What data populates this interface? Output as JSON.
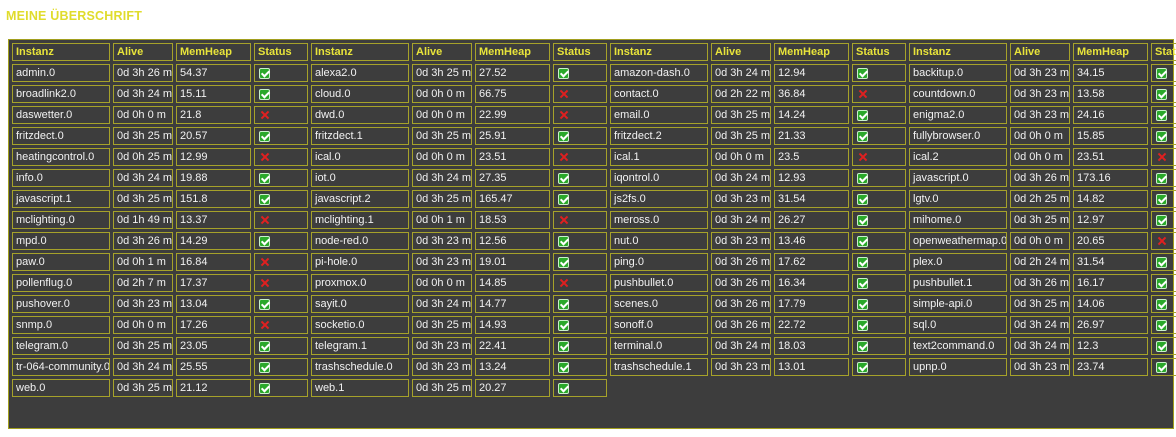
{
  "page": {
    "title": "MEINE ÜBERSCHRIFT"
  },
  "table": {
    "headers": [
      "Instanz",
      "Alive",
      "MemHeap",
      "Status"
    ],
    "column_groups": 4,
    "status_icons": {
      "ok": "check-icon",
      "fail": "cross-icon"
    },
    "colors": {
      "header_text": "#e8e43a",
      "border": "#a6a22a",
      "background": "#3d3d3d",
      "ok": "#2aa82a",
      "fail": "#e02020"
    },
    "rows": [
      [
        {
          "instance": "admin.0",
          "alive": "0d 3h 26 m",
          "memheap": "54.37",
          "ok": true
        },
        {
          "instance": "alexa2.0",
          "alive": "0d 3h 25 m",
          "memheap": "27.52",
          "ok": true
        },
        {
          "instance": "amazon-dash.0",
          "alive": "0d 3h 24 m",
          "memheap": "12.94",
          "ok": true
        },
        {
          "instance": "backitup.0",
          "alive": "0d 3h 23 m",
          "memheap": "34.15",
          "ok": true
        }
      ],
      [
        {
          "instance": "broadlink2.0",
          "alive": "0d 3h 24 m",
          "memheap": "15.11",
          "ok": true
        },
        {
          "instance": "cloud.0",
          "alive": "0d 0h 0 m",
          "memheap": "66.75",
          "ok": false
        },
        {
          "instance": "contact.0",
          "alive": "0d 2h 22 m",
          "memheap": "36.84",
          "ok": false
        },
        {
          "instance": "countdown.0",
          "alive": "0d 3h 23 m",
          "memheap": "13.58",
          "ok": true
        }
      ],
      [
        {
          "instance": "daswetter.0",
          "alive": "0d 0h 0 m",
          "memheap": "21.8",
          "ok": false
        },
        {
          "instance": "dwd.0",
          "alive": "0d 0h 0 m",
          "memheap": "22.99",
          "ok": false
        },
        {
          "instance": "email.0",
          "alive": "0d 3h 25 m",
          "memheap": "14.24",
          "ok": true
        },
        {
          "instance": "enigma2.0",
          "alive": "0d 3h 23 m",
          "memheap": "24.16",
          "ok": true
        }
      ],
      [
        {
          "instance": "fritzdect.0",
          "alive": "0d 3h 25 m",
          "memheap": "20.57",
          "ok": true
        },
        {
          "instance": "fritzdect.1",
          "alive": "0d 3h 25 m",
          "memheap": "25.91",
          "ok": true
        },
        {
          "instance": "fritzdect.2",
          "alive": "0d 3h 25 m",
          "memheap": "21.33",
          "ok": true
        },
        {
          "instance": "fullybrowser.0",
          "alive": "0d 0h 0 m",
          "memheap": "15.85",
          "ok": true
        }
      ],
      [
        {
          "instance": "heatingcontrol.0",
          "alive": "0d 0h 25 m",
          "memheap": "12.99",
          "ok": false
        },
        {
          "instance": "ical.0",
          "alive": "0d 0h 0 m",
          "memheap": "23.51",
          "ok": false
        },
        {
          "instance": "ical.1",
          "alive": "0d 0h 0 m",
          "memheap": "23.5",
          "ok": false
        },
        {
          "instance": "ical.2",
          "alive": "0d 0h 0 m",
          "memheap": "23.51",
          "ok": false
        }
      ],
      [
        {
          "instance": "info.0",
          "alive": "0d 3h 24 m",
          "memheap": "19.88",
          "ok": true
        },
        {
          "instance": "iot.0",
          "alive": "0d 3h 24 m",
          "memheap": "27.35",
          "ok": true
        },
        {
          "instance": "iqontrol.0",
          "alive": "0d 3h 24 m",
          "memheap": "12.93",
          "ok": true
        },
        {
          "instance": "javascript.0",
          "alive": "0d 3h 26 m",
          "memheap": "173.16",
          "ok": true
        }
      ],
      [
        {
          "instance": "javascript.1",
          "alive": "0d 3h 25 m",
          "memheap": "151.8",
          "ok": true
        },
        {
          "instance": "javascript.2",
          "alive": "0d 3h 25 m",
          "memheap": "165.47",
          "ok": true
        },
        {
          "instance": "js2fs.0",
          "alive": "0d 3h 23 m",
          "memheap": "31.54",
          "ok": true
        },
        {
          "instance": "lgtv.0",
          "alive": "0d 2h 25 m",
          "memheap": "14.82",
          "ok": true
        }
      ],
      [
        {
          "instance": "mclighting.0",
          "alive": "0d 1h 49 m",
          "memheap": "13.37",
          "ok": false
        },
        {
          "instance": "mclighting.1",
          "alive": "0d 0h 1 m",
          "memheap": "18.53",
          "ok": false
        },
        {
          "instance": "meross.0",
          "alive": "0d 3h 24 m",
          "memheap": "26.27",
          "ok": true
        },
        {
          "instance": "mihome.0",
          "alive": "0d 3h 25 m",
          "memheap": "12.97",
          "ok": true
        }
      ],
      [
        {
          "instance": "mpd.0",
          "alive": "0d 3h 26 m",
          "memheap": "14.29",
          "ok": true
        },
        {
          "instance": "node-red.0",
          "alive": "0d 3h 23 m",
          "memheap": "12.56",
          "ok": true
        },
        {
          "instance": "nut.0",
          "alive": "0d 3h 23 m",
          "memheap": "13.46",
          "ok": true
        },
        {
          "instance": "openweathermap.0",
          "alive": "0d 0h 0 m",
          "memheap": "20.65",
          "ok": false
        }
      ],
      [
        {
          "instance": "paw.0",
          "alive": "0d 0h 1 m",
          "memheap": "16.84",
          "ok": false
        },
        {
          "instance": "pi-hole.0",
          "alive": "0d 3h 23 m",
          "memheap": "19.01",
          "ok": true
        },
        {
          "instance": "ping.0",
          "alive": "0d 3h 26 m",
          "memheap": "17.62",
          "ok": true
        },
        {
          "instance": "plex.0",
          "alive": "0d 2h 24 m",
          "memheap": "31.54",
          "ok": true
        }
      ],
      [
        {
          "instance": "pollenflug.0",
          "alive": "0d 2h 7 m",
          "memheap": "17.37",
          "ok": false
        },
        {
          "instance": "proxmox.0",
          "alive": "0d 0h 0 m",
          "memheap": "14.85",
          "ok": false
        },
        {
          "instance": "pushbullet.0",
          "alive": "0d 3h 26 m",
          "memheap": "16.34",
          "ok": true
        },
        {
          "instance": "pushbullet.1",
          "alive": "0d 3h 26 m",
          "memheap": "16.17",
          "ok": true
        }
      ],
      [
        {
          "instance": "pushover.0",
          "alive": "0d 3h 23 m",
          "memheap": "13.04",
          "ok": true
        },
        {
          "instance": "sayit.0",
          "alive": "0d 3h 24 m",
          "memheap": "14.77",
          "ok": true
        },
        {
          "instance": "scenes.0",
          "alive": "0d 3h 26 m",
          "memheap": "17.79",
          "ok": true
        },
        {
          "instance": "simple-api.0",
          "alive": "0d 3h 25 m",
          "memheap": "14.06",
          "ok": true
        }
      ],
      [
        {
          "instance": "snmp.0",
          "alive": "0d 0h 0 m",
          "memheap": "17.26",
          "ok": false
        },
        {
          "instance": "socketio.0",
          "alive": "0d 3h 25 m",
          "memheap": "14.93",
          "ok": true
        },
        {
          "instance": "sonoff.0",
          "alive": "0d 3h 26 m",
          "memheap": "22.72",
          "ok": true
        },
        {
          "instance": "sql.0",
          "alive": "0d 3h 24 m",
          "memheap": "26.97",
          "ok": true
        }
      ],
      [
        {
          "instance": "telegram.0",
          "alive": "0d 3h 25 m",
          "memheap": "23.05",
          "ok": true
        },
        {
          "instance": "telegram.1",
          "alive": "0d 3h 23 m",
          "memheap": "22.41",
          "ok": true
        },
        {
          "instance": "terminal.0",
          "alive": "0d 3h 24 m",
          "memheap": "18.03",
          "ok": true
        },
        {
          "instance": "text2command.0",
          "alive": "0d 3h 24 m",
          "memheap": "12.3",
          "ok": true
        }
      ],
      [
        {
          "instance": "tr-064-community.0",
          "alive": "0d 3h 24 m",
          "memheap": "25.55",
          "ok": true
        },
        {
          "instance": "trashschedule.0",
          "alive": "0d 3h 23 m",
          "memheap": "13.24",
          "ok": true
        },
        {
          "instance": "trashschedule.1",
          "alive": "0d 3h 23 m",
          "memheap": "13.01",
          "ok": true
        },
        {
          "instance": "upnp.0",
          "alive": "0d 3h 23 m",
          "memheap": "23.74",
          "ok": true
        }
      ],
      [
        {
          "instance": "web.0",
          "alive": "0d 3h 25 m",
          "memheap": "21.12",
          "ok": true
        },
        {
          "instance": "web.1",
          "alive": "0d 3h 25 m",
          "memheap": "20.27",
          "ok": true
        }
      ]
    ]
  }
}
